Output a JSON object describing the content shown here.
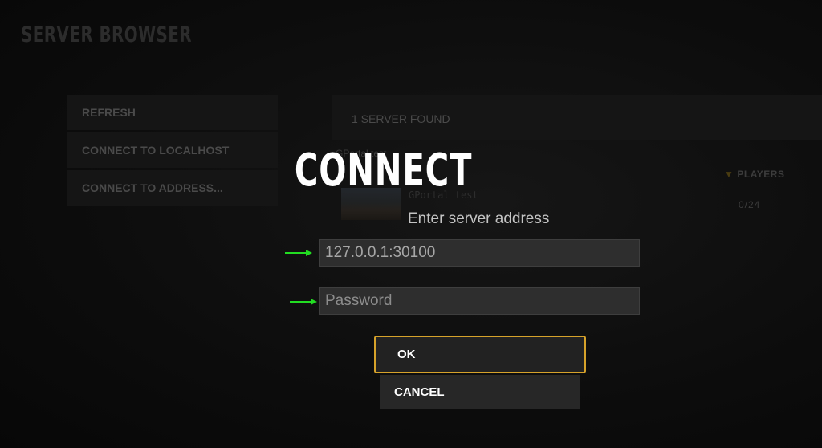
{
  "page": {
    "title": "SERVER BROWSER"
  },
  "sidebar": {
    "items": [
      {
        "label": "REFRESH"
      },
      {
        "label": "CONNECT TO LOCALHOST"
      },
      {
        "label": "CONNECT TO ADDRESS..."
      }
    ]
  },
  "server_list": {
    "header": "1 SERVER FOUND",
    "filter_text": "GPortal test",
    "players_column": "PLAYERS",
    "rows": [
      {
        "title": "GPortal test",
        "players": "0/24"
      }
    ]
  },
  "dialog": {
    "title": "CONNECT",
    "subtitle": "Enter server address",
    "address_value": "127.0.0.1:30100",
    "password_placeholder": "Password",
    "ok_label": "OK",
    "cancel_label": "CANCEL"
  },
  "colors": {
    "accent_border": "#d6a22a",
    "annotation_arrow": "#22dd22"
  }
}
